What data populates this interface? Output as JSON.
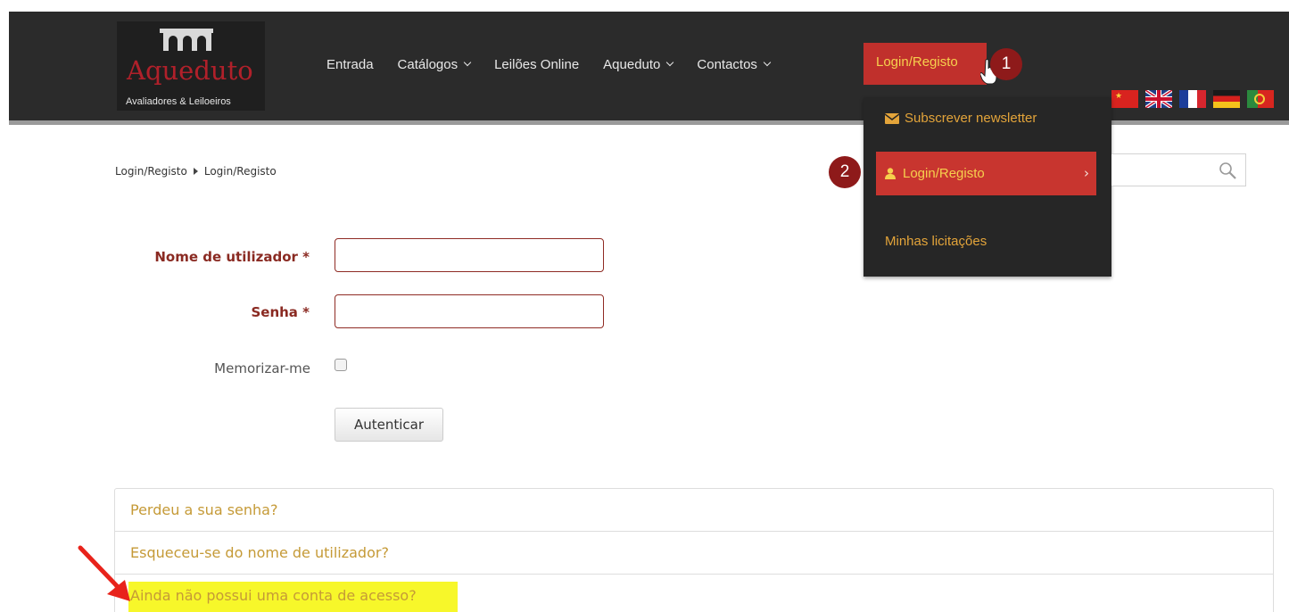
{
  "logo": {
    "name": "Aqueduto",
    "subtitle": "Avaliadores & Leiloeiros"
  },
  "nav": {
    "items": [
      {
        "label": "Entrada",
        "has_caret": false
      },
      {
        "label": "Catálogos",
        "has_caret": true
      },
      {
        "label": "Leilões Online",
        "has_caret": false
      },
      {
        "label": "Aqueduto",
        "has_caret": true
      },
      {
        "label": "Contactos",
        "has_caret": true
      }
    ],
    "active": "Login/Registo"
  },
  "annotations": {
    "step1": "1",
    "step2": "2"
  },
  "flags": [
    "china-flag-icon",
    "uk-flag-icon",
    "france-flag-icon",
    "germany-flag-icon",
    "portugal-flag-icon"
  ],
  "dropdown": {
    "newsletter": "Subscrever newsletter",
    "login": "Login/Registo",
    "bids": "Minhas licitações",
    "arrow": "›"
  },
  "breadcrumb": {
    "first": "Login/Registo",
    "second": "Login/Registo"
  },
  "form": {
    "username_label": "Nome de utilizador *",
    "username_value": "",
    "password_label": "Senha *",
    "password_value": "",
    "remember_label": "Memorizar-me",
    "remember_checked": false,
    "submit_label": "Autenticar"
  },
  "links": [
    "Perdeu a sua senha?",
    "Esqueceu-se do nome de utilizador?",
    "Ainda não possui uma conta de acesso?"
  ],
  "colors": {
    "header_bg": "#2b2b2b",
    "brand_red": "#b0202a",
    "active_bg": "#c0302c",
    "link_gold": "#c59a37",
    "highlight": "#f7f72a"
  }
}
